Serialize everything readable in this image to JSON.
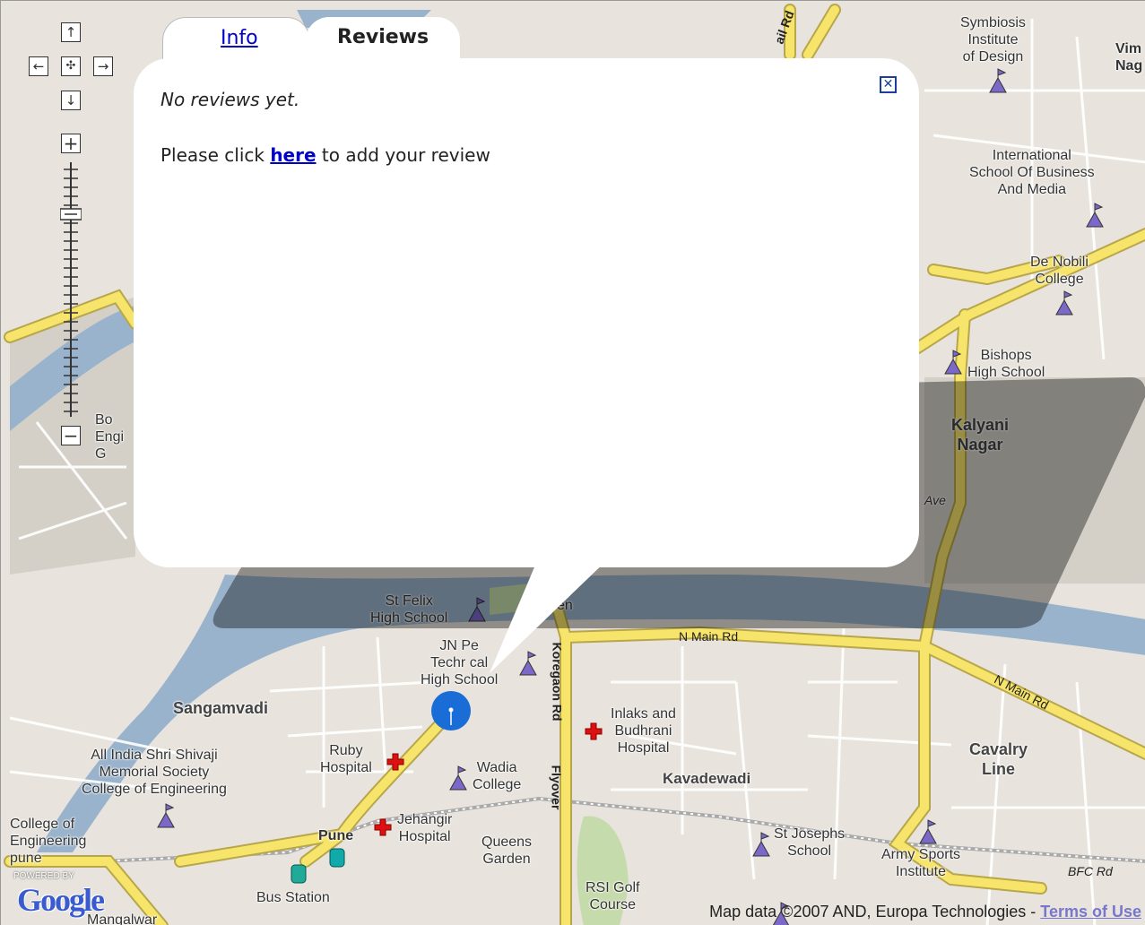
{
  "info_window": {
    "tabs": [
      {
        "label": "Info",
        "active": false
      },
      {
        "label": "Reviews",
        "active": true
      }
    ],
    "close_icon": "close-x-icon",
    "no_reviews_text": "No reviews yet.",
    "prompt_before": "Please click ",
    "prompt_link": "here",
    "prompt_after": " to add your review"
  },
  "controls": {
    "pan_up": "↑",
    "pan_left": "←",
    "pan_center": "✣",
    "pan_right": "→",
    "pan_down": "↓",
    "zoom_in": "+",
    "zoom_out": "−"
  },
  "labels": {
    "symbiosis": "Symbiosis\nInstitute\nof Design",
    "vim": "Vim\nNag",
    "intl_school": "International\nSchool Of Business\nAnd Media",
    "de_nobili": "De Nobili\nCollege",
    "bishops": "Bishops\nHigh School",
    "kalyani": "Kalyani\nNagar",
    "ave": "Ave",
    "bo_eng": "Bo\nEngi\nG",
    "st_felix": "St Felix\nHigh School",
    "en": "en",
    "jn_petit": "JN Pe\nTechr cal\nHigh School",
    "koregaon": "Koregaon Rd",
    "n_main_rd_1": "N Main Rd",
    "n_main_rd_2": "N Main Rd",
    "sangamvadi": "Sangamvadi",
    "inlaks": "Inlaks and\nBudhrani\nHospital",
    "cavalry": "Cavalry\nLine",
    "all_india": "All India Shri Shivaji\nMemorial Society\nCollege of Engineering",
    "ruby": "Ruby\nHospital",
    "wadia": "Wadia\nCollege",
    "kavadewadi": "Kavadewadi",
    "flyover": "Flyover",
    "college_of_eng": "College of\nEngineering\npune",
    "pune": "Pune",
    "jehangir": "Jehangir\nHospital",
    "queens": "Queens\nGarden",
    "st_josephs": "St Josephs\nSchool",
    "army": "Army Sports\nInstitute",
    "bfc": "BFC Rd",
    "bus_station": "Bus Station",
    "rsi": "RSI Golf\nCourse",
    "mangalwar": "Mangalwar",
    "ail_rd": "ail Rd"
  },
  "footer": {
    "powered_by": "POWERED BY",
    "logo": "Google",
    "copyright": "Map data ©2007 AND, Europa Technologies - ",
    "terms": "Terms of Use"
  },
  "colors": {
    "water": "#99b3cc",
    "road_major": "#f7e46b",
    "land": "#e8e4dd",
    "park": "#c6dbac",
    "link": "#0000cc"
  }
}
